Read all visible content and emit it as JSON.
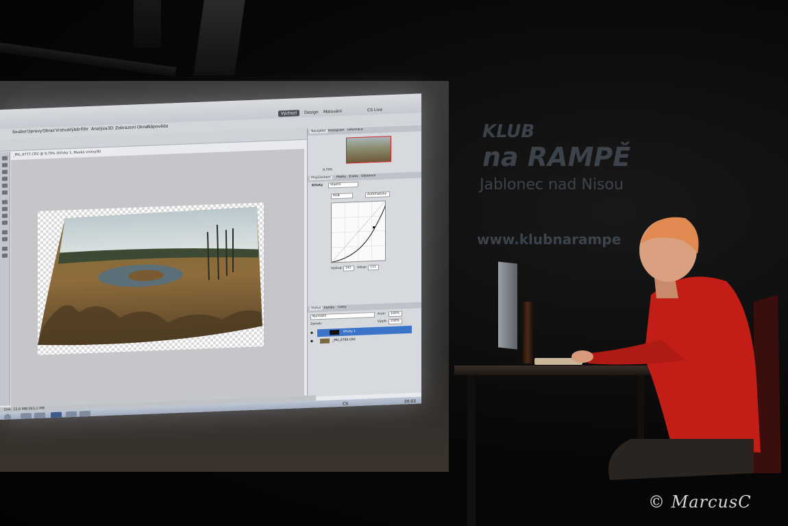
{
  "photo_caption": "",
  "watermark": "© MarcusC",
  "background_sign": {
    "line1": "KLUB",
    "line2": "na RAMPĚ",
    "line3": "Jablonec nad Nisou",
    "url": "www.klubnarampe"
  },
  "projected_app": {
    "workspace_buttons": [
      "Výchozí",
      "Design",
      "Malování"
    ],
    "active_workspace": "Výchozí",
    "cs_live": "CS Live",
    "menu": [
      "Soubor",
      "Úpravy",
      "Obraz",
      "Vrstva",
      "Výběr",
      "Filtr",
      "Analýza",
      "3D",
      "Zobrazení",
      "Okna",
      "Nápověda"
    ],
    "document_tab": "_MG_6777.CR2 @ 9,79% (Křivky 1, Maska vrstvy/8)",
    "status": "Dok: 23,6 MB/383,2 MB",
    "navigator_tabs": [
      "Navigátor",
      "Histogram",
      "Informace"
    ],
    "zoom": "9,79%",
    "adjust_tabs": [
      "Přizpůsobení",
      "Masky",
      "Znaky",
      "Odstavce"
    ],
    "adjust_title": "Křivky",
    "preset": "Vlastní",
    "channel": "RGB",
    "auto_button": "Automaticky",
    "output_label": "Výstup:",
    "output_value": "142",
    "input_label": "Vstup:",
    "input_value": "111",
    "layers_tabs": [
      "Vrstvy",
      "Kanály",
      "Cesty"
    ],
    "blend_mode": "Normální",
    "opacity_label": "Krytí:",
    "opacity_value": "100%",
    "lock_label": "Zámek:",
    "fill_label": "Výplň:",
    "fill_value": "100%",
    "layers": [
      {
        "name": "Křivky 1",
        "selected": true
      },
      {
        "name": "_MG_6765.CR2",
        "selected": false
      }
    ],
    "taskbar_lang": "CS",
    "clock": "20:03"
  }
}
